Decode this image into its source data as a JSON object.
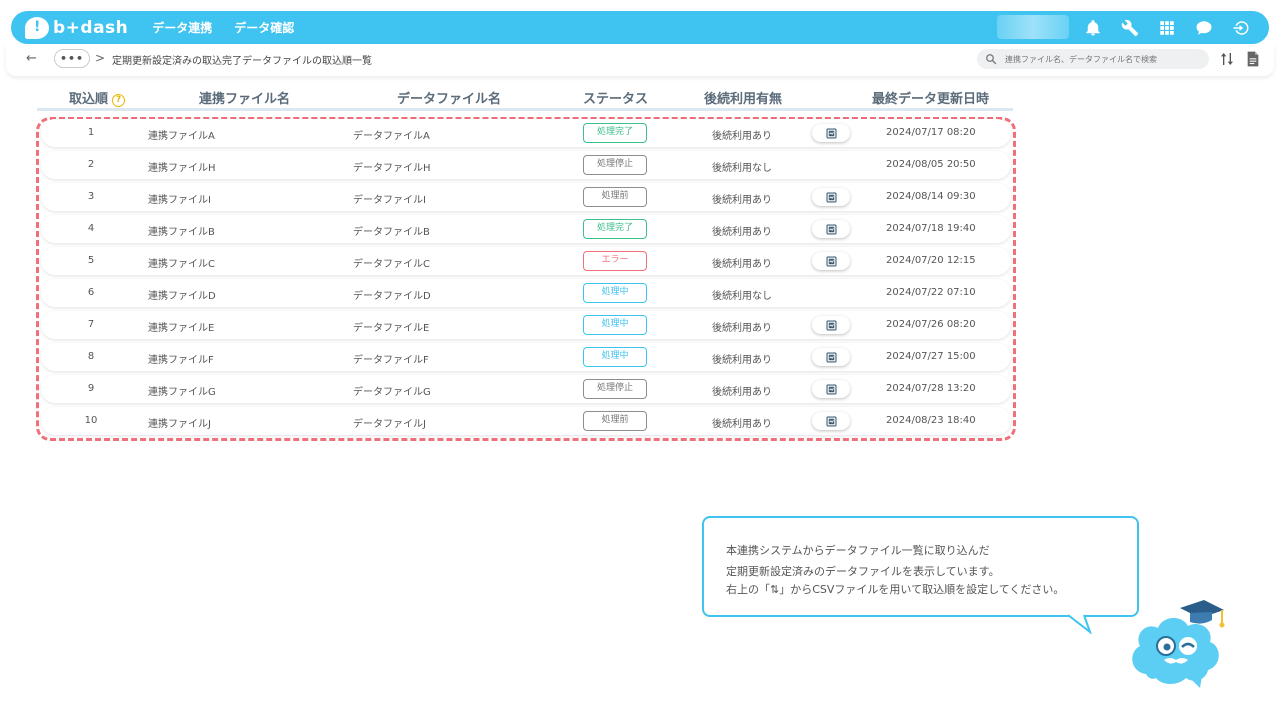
{
  "app": {
    "logo_text": "b+dash",
    "nav": [
      "データ連携",
      "データ確認"
    ]
  },
  "breadcrumb": {
    "back": "←",
    "dots": "•••",
    "sep": ">",
    "title": "定期更新設定済みの取込完了データファイルの取込順一覧"
  },
  "search": {
    "placeholder": "連携ファイル名、データファイル名で検索"
  },
  "table": {
    "headers": {
      "order": "取込順",
      "help": "?",
      "link_file": "連携ファイル名",
      "data_file": "データファイル名",
      "status": "ステータス",
      "usage": "後続利用有無",
      "updated": "最終データ更新日時"
    },
    "rows": [
      {
        "no": "1",
        "link": "連携ファイルA",
        "data": "データファイルA",
        "status": "処理完了",
        "st": "done",
        "use": "後続利用あり",
        "btn": true,
        "date": "2024/07/17 08:20"
      },
      {
        "no": "2",
        "link": "連携ファイルH",
        "data": "データファイルH",
        "status": "処理停止",
        "st": "stop",
        "use": "後続利用なし",
        "btn": false,
        "date": "2024/08/05 20:50"
      },
      {
        "no": "3",
        "link": "連携ファイルI",
        "data": "データファイルI",
        "status": "処理前",
        "st": "pre",
        "use": "後続利用あり",
        "btn": true,
        "date": "2024/08/14 09:30"
      },
      {
        "no": "4",
        "link": "連携ファイルB",
        "data": "データファイルB",
        "status": "処理完了",
        "st": "done",
        "use": "後続利用あり",
        "btn": true,
        "date": "2024/07/18 19:40"
      },
      {
        "no": "5",
        "link": "連携ファイルC",
        "data": "データファイルC",
        "status": "エラー",
        "st": "err",
        "use": "後続利用あり",
        "btn": true,
        "date": "2024/07/20 12:15"
      },
      {
        "no": "6",
        "link": "連携ファイルD",
        "data": "データファイルD",
        "status": "処理中",
        "st": "run",
        "use": "後続利用なし",
        "btn": false,
        "date": "2024/07/22 07:10"
      },
      {
        "no": "7",
        "link": "連携ファイルE",
        "data": "データファイルE",
        "status": "処理中",
        "st": "run",
        "use": "後続利用あり",
        "btn": true,
        "date": "2024/07/26 08:20"
      },
      {
        "no": "8",
        "link": "連携ファイルF",
        "data": "データファイルF",
        "status": "処理中",
        "st": "run",
        "use": "後続利用あり",
        "btn": true,
        "date": "2024/07/27 15:00"
      },
      {
        "no": "9",
        "link": "連携ファイルG",
        "data": "データファイルG",
        "status": "処理停止",
        "st": "stop",
        "use": "後続利用あり",
        "btn": true,
        "date": "2024/07/28 13:20"
      },
      {
        "no": "10",
        "link": "連携ファイルJ",
        "data": "データファイルJ",
        "status": "処理前",
        "st": "pre",
        "use": "後続利用あり",
        "btn": true,
        "date": "2024/08/23 18:40"
      }
    ]
  },
  "help_bubble": {
    "lines": [
      "本連携システムからデータファイル一覧に取り込んだ",
      "定期更新設定済みのデータファイルを表示しています。",
      "右上の「⇅」からCSVファイルを用いて取込順を設定してください。"
    ]
  },
  "colors": {
    "brand": "#3fc3f0",
    "highlight_border": "#ef6f7a",
    "status_done": "#3cc08a",
    "status_error": "#ef6f7a",
    "status_running": "#3fc3f0"
  },
  "icons": [
    "bell-icon",
    "wrench-icon",
    "grid-icon",
    "chat-icon",
    "logout-icon",
    "search-icon",
    "sort-icon",
    "file-icon",
    "data-view-icon",
    "help-icon"
  ]
}
